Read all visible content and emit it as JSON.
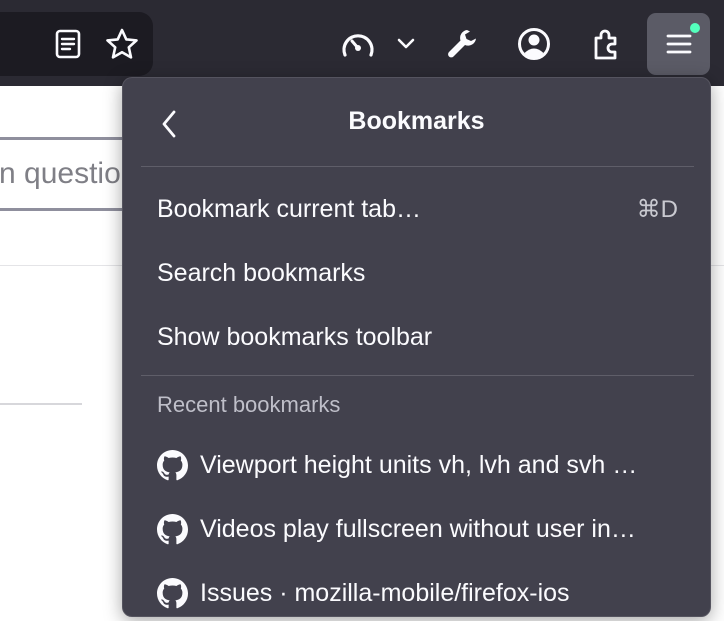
{
  "toolbar": {
    "icons": [
      "reader-view-icon",
      "bookmark-star-icon",
      "speedometer-icon",
      "chevron-down-icon",
      "wrench-icon",
      "account-icon",
      "extensions-icon",
      "hamburger-menu-icon"
    ],
    "menu_badge_color": "#54ffbd"
  },
  "page": {
    "input_placeholder": "n questio"
  },
  "panel": {
    "title": "Bookmarks",
    "items": [
      {
        "label": "Bookmark current tab…",
        "shortcut": "⌘D"
      },
      {
        "label": "Search bookmarks",
        "shortcut": ""
      },
      {
        "label": "Show bookmarks toolbar",
        "shortcut": ""
      }
    ],
    "recent_label": "Recent bookmarks",
    "recent": [
      {
        "icon": "github-icon",
        "label": "Viewport height units vh, lvh and svh …"
      },
      {
        "icon": "github-icon",
        "label": "Videos play fullscreen without user in…"
      },
      {
        "icon": "github-icon",
        "label": "Issues · mozilla-mobile/firefox-ios"
      }
    ]
  },
  "colors": {
    "toolbar_bg": "#2b2a33",
    "panel_bg": "#42414d",
    "text": "#fbfbfe"
  }
}
